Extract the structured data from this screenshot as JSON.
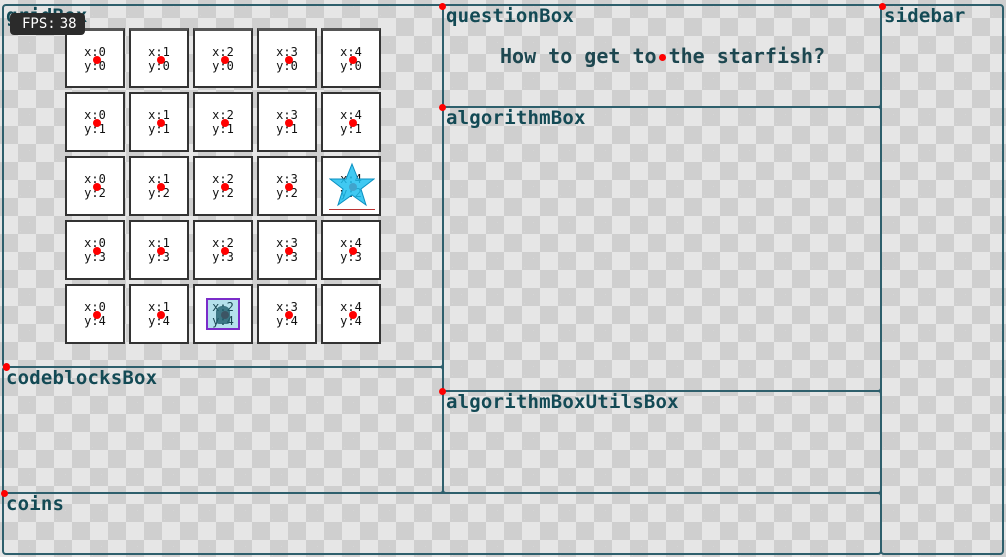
{
  "hud": {
    "fps_label": "FPS:",
    "fps_value": "38"
  },
  "boxes": {
    "grid": "gridBox",
    "question": "questionBox",
    "sidebar": "sidebar",
    "algorithm": "algorithmBox",
    "codeblocks": "codeblocksBox",
    "algorithm_utils": "algorithmBoxUtilsBox",
    "coins": "coins"
  },
  "question": {
    "text": "How to get to the starfish?"
  },
  "grid": {
    "columns": 5,
    "rows": 5,
    "goal": {
      "x": 4,
      "y": 2,
      "icon": "starfish-icon",
      "color": "#1ec0f0"
    },
    "player": {
      "x": 2,
      "y": 4,
      "icon": "player-character-icon",
      "highlight_color": "#7b2cc9"
    }
  },
  "colors": {
    "box_border": "#2e5f6c",
    "anchor": "#ff0000",
    "label": "#134a55"
  }
}
